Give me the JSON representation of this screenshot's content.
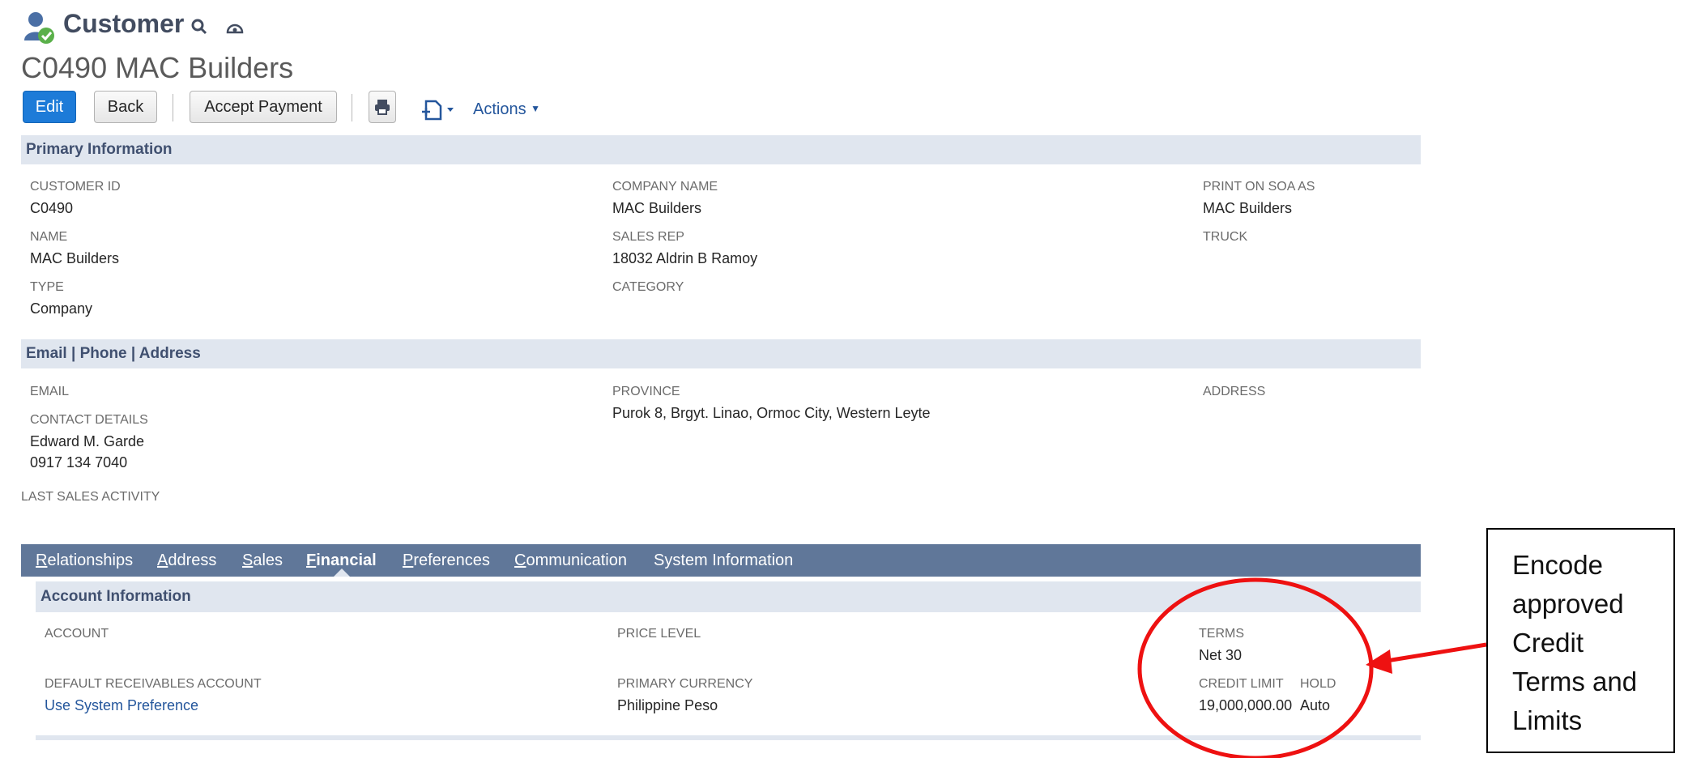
{
  "header": {
    "record_type": "Customer",
    "record_title": "C0490 MAC Builders",
    "icons": [
      "customer-check-icon",
      "search-icon",
      "dashboard-icon"
    ]
  },
  "toolbar": {
    "edit_label": "Edit",
    "back_label": "Back",
    "accept_payment_label": "Accept Payment",
    "actions_label": "Actions",
    "icons": [
      "print-icon",
      "new-document-icon"
    ]
  },
  "primary": {
    "section_title": "Primary Information",
    "customer_id_label": "CUSTOMER ID",
    "customer_id_value": "C0490",
    "name_label": "NAME",
    "name_value": "MAC Builders",
    "type_label": "TYPE",
    "type_value": "Company",
    "company_name_label": "COMPANY NAME",
    "company_name_value": "MAC Builders",
    "sales_rep_label": "SALES REP",
    "sales_rep_value": "18032 Aldrin B Ramoy",
    "category_label": "CATEGORY",
    "print_on_soa_label": "PRINT ON SOA AS",
    "print_on_soa_value": "MAC Builders",
    "truck_label": "TRUCK"
  },
  "contact": {
    "section_title": "Email | Phone | Address",
    "email_label": "EMAIL",
    "contact_details_label": "CONTACT DETAILS",
    "contact_name": "Edward M. Garde",
    "contact_phone": "0917 134 7040",
    "province_label": "PROVINCE",
    "province_value": "Purok 8, Brgyt. Linao, Ormoc City, Western Leyte",
    "address_label": "ADDRESS",
    "last_sales_activity_label": "LAST SALES ACTIVITY"
  },
  "tabs": {
    "relationships": {
      "accel": "R",
      "rest": "elationships"
    },
    "address": {
      "accel": "A",
      "rest": "ddress"
    },
    "sales": {
      "accel": "S",
      "rest": "ales"
    },
    "financial": {
      "accel": "F",
      "rest": "inancial"
    },
    "preferences": {
      "accel": "P",
      "rest": "references"
    },
    "communication": {
      "accel": "C",
      "rest": "ommunication"
    },
    "system_information": "System Information",
    "active": "Financial"
  },
  "financial": {
    "section_title": "Account Information",
    "account_label": "ACCOUNT",
    "default_receivables_label": "DEFAULT RECEIVABLES ACCOUNT",
    "default_receivables_value": "Use System Preference",
    "price_level_label": "PRICE LEVEL",
    "primary_currency_label": "PRIMARY CURRENCY",
    "primary_currency_value": "Philippine Peso",
    "terms_label": "TERMS",
    "terms_value": "Net 30",
    "credit_limit_label": "CREDIT LIMIT",
    "credit_limit_value": "19,000,000.00",
    "hold_label": "HOLD",
    "hold_value": "Auto"
  },
  "annotation": {
    "lines": [
      "Encode",
      "approved",
      "Credit",
      "Terms and",
      "Limits"
    ],
    "color": "#ee1111"
  },
  "colors": {
    "section_bg": "#e0e6ef",
    "tab_bar": "#607799",
    "primary_button": "#1d7bd8",
    "link": "#24569c"
  }
}
